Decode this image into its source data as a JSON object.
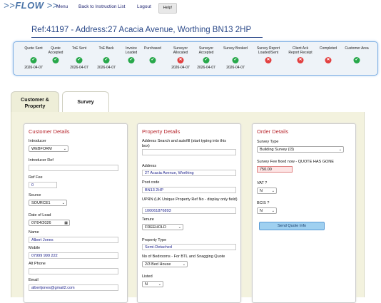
{
  "app": {
    "logo": "FLOW",
    "logo_prefix": ">>",
    "logo_suffix": ">>"
  },
  "nav": {
    "menu": "Menu",
    "back": "Back to Instruction List",
    "logout": "Logout",
    "help": "Help!"
  },
  "ref_title": "Ref:41197 - Address:27 Acacia Avenue, Worthing BN13 2HP",
  "stages": [
    {
      "label1": "Quote Sent",
      "label2": "",
      "status": "ok",
      "date": "2026-04-07"
    },
    {
      "label1": "Quote",
      "label2": "Accepted",
      "status": "ok",
      "date": ""
    },
    {
      "label1": "ToE Sent",
      "label2": "",
      "status": "ok",
      "date": "2026-04-07"
    },
    {
      "label1": "ToE Back",
      "label2": "",
      "status": "ok",
      "date": "2026-04-07"
    },
    {
      "label1": "Invoice",
      "label2": "Loaded",
      "status": "ok",
      "date": ""
    },
    {
      "label1": "Purchased",
      "label2": "",
      "status": "ok",
      "date": ""
    },
    {
      "label1": "Surveyor",
      "label2": "Allocated",
      "status": "bad",
      "date": "2026-04-07"
    },
    {
      "label1": "Surveyor",
      "label2": "Accepted",
      "status": "ok",
      "date": "2026-04-07"
    },
    {
      "label1": "Survey Booked",
      "label2": "",
      "status": "ok",
      "date": "2026-04-07"
    },
    {
      "label1": "Survey Report",
      "label2": "Loaded/Sent",
      "status": "bad",
      "date": ""
    },
    {
      "label1": "Client Ack",
      "label2": "Report Receipt",
      "status": "bad",
      "date": ""
    },
    {
      "label1": "Completed",
      "label2": "",
      "status": "bad",
      "date": ""
    },
    {
      "label1": "Customer Area",
      "label2": "",
      "status": "ok",
      "date": ""
    }
  ],
  "tabs": {
    "customer_property": "Customer & Property",
    "survey": "Survey"
  },
  "customer": {
    "heading": "Customer Details",
    "introducer_label": "Introducer",
    "introducer_value": "WEBFORM",
    "introducer_ref_label": "Introducer Ref",
    "introducer_ref_value": "",
    "ref_fee_label": "Ref Fee",
    "ref_fee_value": "0",
    "source_label": "Source",
    "source_value": "SOURCE1",
    "date_of_lead_label": "Date of Lead",
    "date_of_lead_value": "07/04/2026",
    "name_label": "Name",
    "name_value": "Albert Jones",
    "mobile_label": "Mobile",
    "mobile_value": "07999 999 222",
    "alt_phone_label": "Alt Phone",
    "alt_phone_value": "",
    "email_label": "Email",
    "email_value": "albertjones@gmail2.com"
  },
  "property": {
    "heading": "Property Details",
    "search_label": "Address Search and autofill (start typing into this box)",
    "search_value": "",
    "address_label": "Address",
    "address_value": "27 Acacia Avenue, Worthing",
    "postcode_label": "Post code",
    "postcode_value": "BN13 2HP",
    "uprn_label": "UPRN (UK Unique Property Ref No - display only field)",
    "uprn_value": "100061876893",
    "tenure_label": "Tenure",
    "tenure_value": "FREEHOLD",
    "type_label": "Property Type",
    "type_value": "Semi-Detached",
    "bedrooms_label": "No of Bedrooms - For BTL and Snagging Quote",
    "bedrooms_value": "2/3 Bed House",
    "listed_label": "Listed",
    "listed_value": "N"
  },
  "order": {
    "heading": "Order Details",
    "survey_type_label": "Survey Type",
    "survey_type_value": "Building Survey (I3)",
    "fee_label": "Survey Fee fixed now - QUOTE HAS GONE",
    "fee_value": "750.00",
    "vat_label": "VAT ?",
    "vat_value": "N",
    "bcis_label": "BCIS ?",
    "bcis_value": "N",
    "send_quote_button": "Send Quote Info"
  },
  "colors": {
    "ok": "#27a84a",
    "bad": "#e24040",
    "heading_red": "#b7262d",
    "title_blue": "#2c4a8a"
  }
}
